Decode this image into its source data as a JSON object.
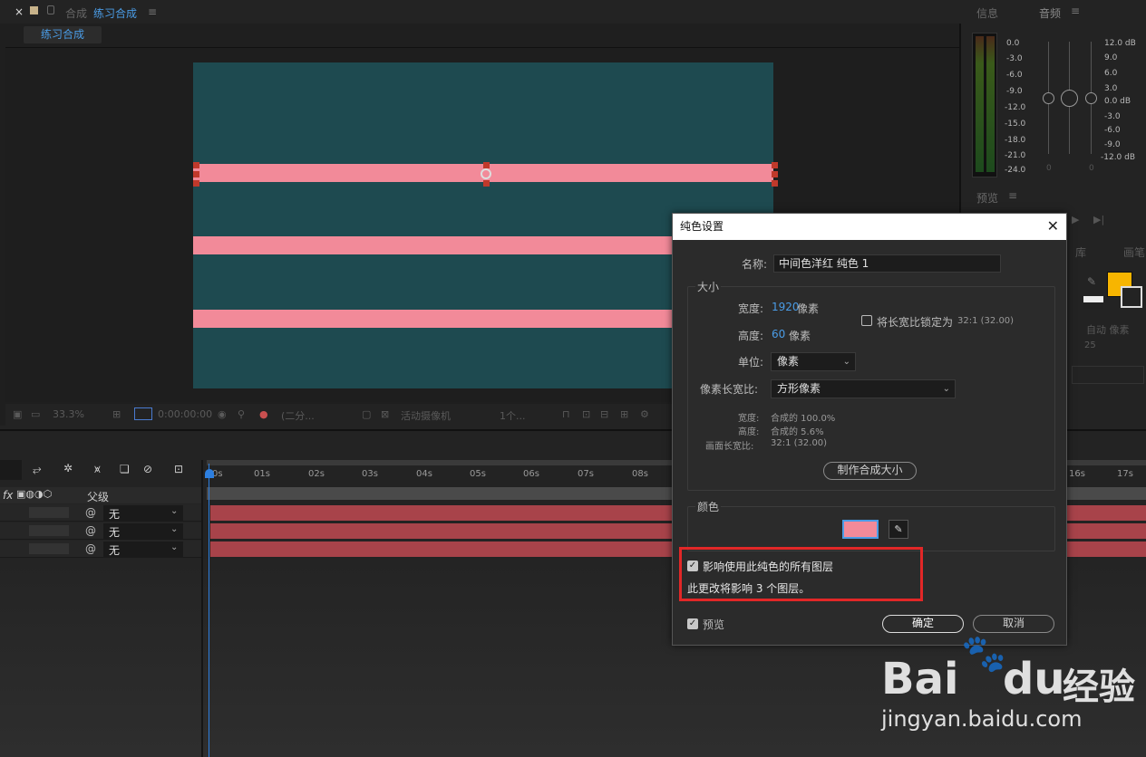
{
  "comp_panel": {
    "close": "×",
    "tab_prefix": "合成",
    "tab_name": "练习合成",
    "menu": "≡",
    "subtab": "练习合成",
    "toolbar": {
      "zoom": "33.3%",
      "timecode": "0:00:00:00",
      "resolution": "(二分...",
      "camera": "活动摄像机",
      "views": "1个..."
    }
  },
  "audio_panel": {
    "tab_info": "信息",
    "tab_audio": "音频",
    "left_scale": [
      "0.0",
      "-3.0",
      "-6.0",
      "-9.0",
      "-12.0",
      "-15.0",
      "-18.0",
      "-21.0",
      "-24.0"
    ],
    "right_scale": [
      "12.0 dB",
      "9.0",
      "6.0",
      "3.0",
      "0.0 dB",
      "-3.0",
      "-6.0",
      "-9.0",
      "-12.0 dB"
    ],
    "slider_values": [
      "0",
      "0"
    ]
  },
  "preview_panel": {
    "title": "预览"
  },
  "props_panel": {
    "tab1": "库",
    "tab2": "画笔",
    "auto": "自动 像素",
    "value": "25",
    "accent": "#f7b500"
  },
  "timeline": {
    "ruler": [
      "0s",
      "01s",
      "02s",
      "03s",
      "04s",
      "05s",
      "06s",
      "07s",
      "08s",
      "16s",
      "17s"
    ],
    "parent_header": "父级",
    "fx": "fx",
    "layers": [
      {
        "parent": "无"
      },
      {
        "parent": "无"
      },
      {
        "parent": "无"
      }
    ]
  },
  "dialog": {
    "title": "纯色设置",
    "close": "✕",
    "name_label": "名称:",
    "name_value": "中间色洋红 纯色 1",
    "size_group": "大小",
    "width_label": "宽度:",
    "width_value": "1920",
    "width_unit": "像素",
    "height_label": "高度:",
    "height_value": "60",
    "height_unit": "像素",
    "lock_label": "将长宽比锁定为",
    "lock_ratio": "32:1 (32.00)",
    "unit_label": "单位:",
    "unit_value": "像素",
    "par_label": "像素长宽比:",
    "par_value": "方形像素",
    "info_width_label": "宽度:",
    "info_width_value": "合成的 100.0%",
    "info_height_label": "高度:",
    "info_height_value": "合成的 5.6%",
    "info_frame_label": "画面长宽比:",
    "info_frame_value": "32:1 (32.00)",
    "make_comp_size": "制作合成大小",
    "color_group": "颜色",
    "swatch_color": "#f28a99",
    "affect_label": "影响使用此纯色的所有图层",
    "affect_note": "此更改将影响 3 个图层。",
    "preview_label": "预览",
    "ok": "确定",
    "cancel": "取消"
  },
  "canvas": {
    "background": "#1e4a50",
    "bar_color": "#f28a99"
  },
  "watermark": {
    "brand_left": "Bai",
    "brand_right": "du",
    "brand_cn": "经验",
    "url": "jingyan.baidu.com"
  }
}
